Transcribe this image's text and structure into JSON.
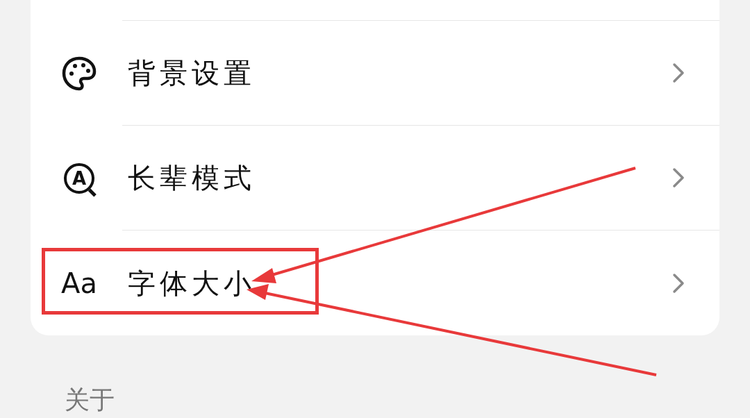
{
  "settings_rows": [
    {
      "kind": "palette",
      "label": "背景设置"
    },
    {
      "kind": "magnifier_letter",
      "icon_text": "A",
      "label": "长辈模式"
    },
    {
      "kind": "letters",
      "icon_text": "Aa",
      "label": "字体大小"
    }
  ],
  "section_header": "关于"
}
